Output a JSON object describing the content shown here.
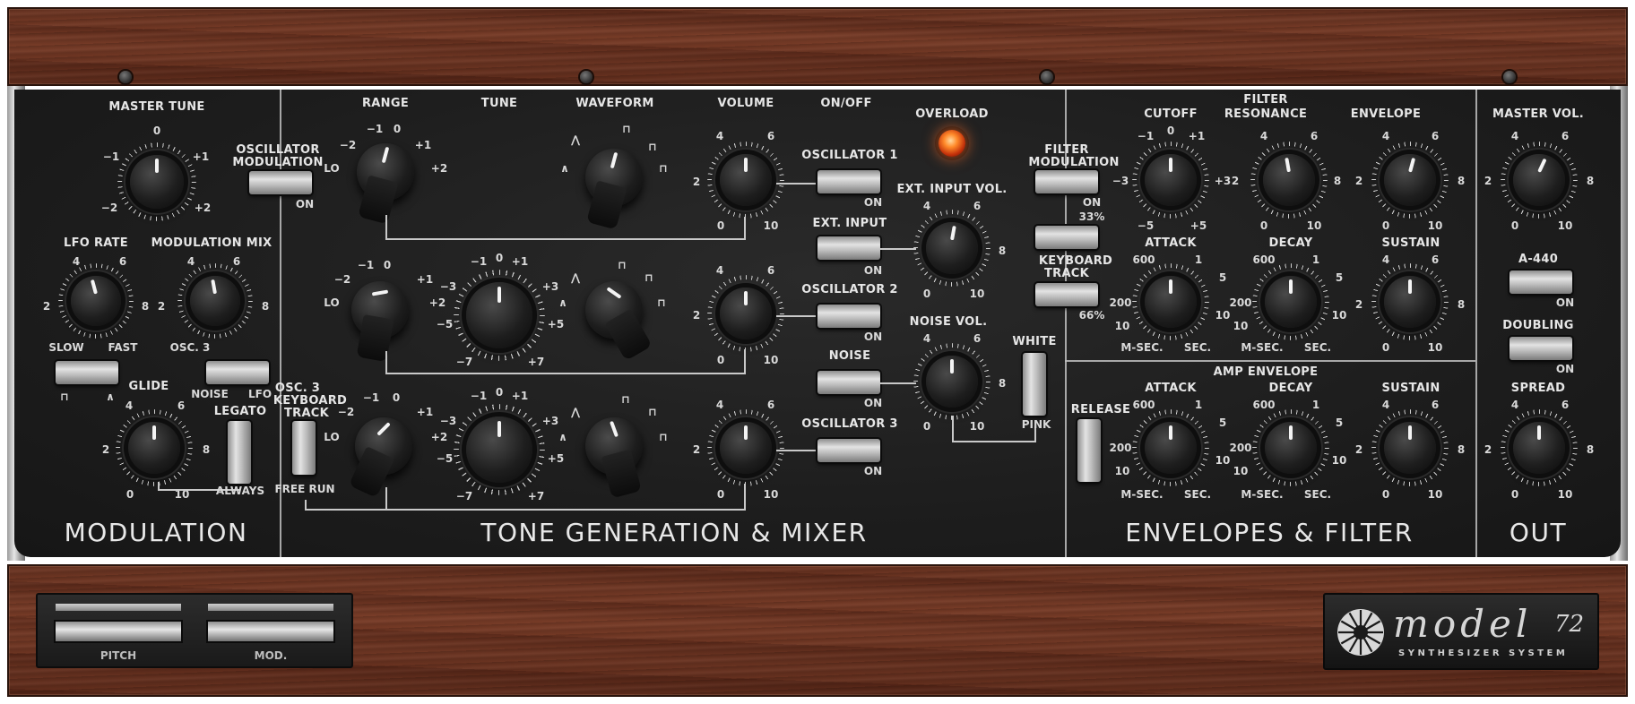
{
  "sections": {
    "modulation": "MODULATION",
    "tone": "TONE GENERATION & MIXER",
    "envelopes": "ENVELOPES & FILTER",
    "out": "OUT"
  },
  "modulation": {
    "master_tune": "MASTER TUNE",
    "mt_scale": [
      "0",
      "−1",
      "+1",
      "−2",
      "+2"
    ],
    "osc_mod": [
      "OSCILLATOR",
      "MODULATION"
    ],
    "on": "ON",
    "lfo_rate": "LFO RATE",
    "mod_mix": "MODULATION MIX",
    "scale_a": [
      "4",
      "6",
      "2",
      "8"
    ],
    "slow": "SLOW",
    "fast": "FAST",
    "osc3": "OSC. 3",
    "noise": "NOISE",
    "lfo": "LFO",
    "glide": "GLIDE",
    "legato": "LEGATO",
    "always": "ALWAYS",
    "scale_b": [
      "4",
      "6",
      "2",
      "8",
      "0",
      "10"
    ]
  },
  "tone": {
    "range": "RANGE",
    "tune": "TUNE",
    "waveform": "WAVEFORM",
    "volume": "VOLUME",
    "on_off": "ON/OFF",
    "range_scale": [
      "−1",
      "0",
      "−2",
      "+1",
      "LO",
      "+2"
    ],
    "tune_scale": [
      "−1",
      "0",
      "+1",
      "−3",
      "+3",
      "−5",
      "+5",
      "−7",
      "+7"
    ],
    "osc3_kbd": [
      "OSC. 3",
      "KEYBOARD",
      "TRACK"
    ],
    "free_run": "FREE RUN",
    "mixer": [
      "OSCILLATOR 1",
      "EXT. INPUT",
      "OSCILLATOR 2",
      "NOISE",
      "OSCILLATOR 3"
    ],
    "on": "ON",
    "overload": "OVERLOAD",
    "ext_input_vol": "EXT. INPUT VOL.",
    "noise_vol": "NOISE VOL.",
    "white": "WHITE",
    "pink": "PINK",
    "vol_scale": [
      "4",
      "6",
      "2",
      "8",
      "0",
      "10"
    ]
  },
  "filter": {
    "filter_mod": [
      "FILTER",
      "MODULATION"
    ],
    "on": "ON",
    "pct33": "33%",
    "kbd_track": [
      "KEYBOARD",
      "TRACK"
    ],
    "pct66": "66%",
    "filter": "FILTER",
    "cutoff": "CUTOFF",
    "resonance": "RESONANCE",
    "envelope": "ENVELOPE",
    "cutoff_scale": [
      "0",
      "−1",
      "+1",
      "−3",
      "+3",
      "−5",
      "+5"
    ],
    "attack": "ATTACK",
    "decay": "DECAY",
    "sustain": "SUSTAIN",
    "time_scale": [
      "600",
      "1",
      "5",
      "200",
      "10",
      "10"
    ],
    "msec": "M-SEC.",
    "sec": "SEC.",
    "amp_envelope": "AMP ENVELOPE",
    "release": "RELEASE",
    "num_scale": [
      "4",
      "6",
      "2",
      "8",
      "0",
      "10"
    ]
  },
  "out": {
    "master_vol": "MASTER VOL.",
    "a440": "A-440",
    "on": "ON",
    "doubling": "DOUBLING",
    "spread": "SPREAD",
    "scale": [
      "4",
      "6",
      "2",
      "8",
      "0",
      "10"
    ]
  },
  "wheels": {
    "pitch": "PITCH",
    "mod": "MOD."
  },
  "logo": {
    "model": "model",
    "number": "72",
    "subtitle": "SYNTHESIZER SYSTEM"
  }
}
